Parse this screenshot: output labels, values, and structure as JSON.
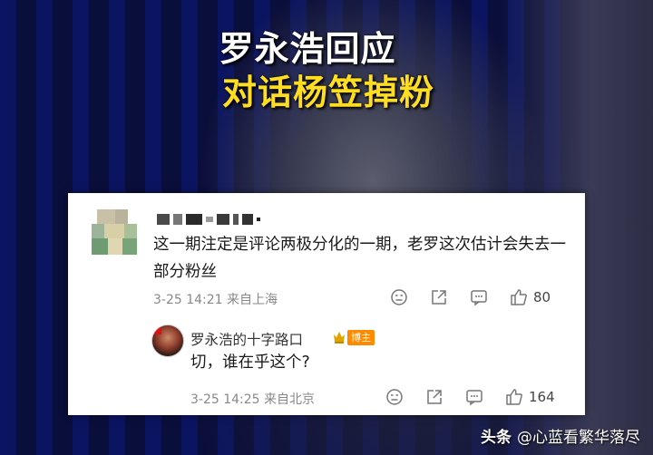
{
  "headline": {
    "line1": "罗永浩回应",
    "line2": "对话杨笠掉粉"
  },
  "comment": {
    "text": "这一期注定是评论两极分化的一期，老罗这次估计会失去一部分粉丝",
    "time": "3-25 14:21 来自上海",
    "like_count": "80"
  },
  "reply": {
    "username": "罗永浩的十字路口",
    "badge": "博主",
    "text": "切，谁在乎这个?",
    "time": "3-25 14:25 来自北京",
    "like_count": "164"
  },
  "watermark": {
    "brand": "头条",
    "author": "@心蓝看繁华落尽"
  },
  "colors": {
    "headline_white": "#ffffff",
    "headline_yellow": "#ffdd1f",
    "badge_orange": "#ff8a00"
  },
  "icons": [
    "dislike-icon",
    "share-icon",
    "comment-icon",
    "like-icon"
  ]
}
